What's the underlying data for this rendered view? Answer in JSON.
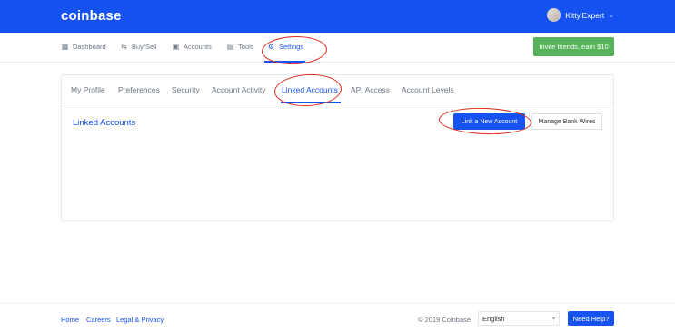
{
  "header": {
    "logo": "coinbase",
    "username": "Kitty.Expert",
    "dropdown_icon": "chevron-down-icon"
  },
  "nav": {
    "items": [
      {
        "label": "Dashboard",
        "icon": "dashboard-icon"
      },
      {
        "label": "Buy/Sell",
        "icon": "swap-icon"
      },
      {
        "label": "Accounts",
        "icon": "wallet-icon"
      },
      {
        "label": "Tools",
        "icon": "briefcase-icon"
      },
      {
        "label": "Settings",
        "icon": "gear-icon",
        "active": true
      }
    ],
    "invite_label": "Invite friends, earn $10"
  },
  "settings": {
    "tabs": [
      {
        "label": "My Profile"
      },
      {
        "label": "Preferences"
      },
      {
        "label": "Security"
      },
      {
        "label": "Account Activity"
      },
      {
        "label": "Linked Accounts",
        "active": true
      },
      {
        "label": "API Access"
      },
      {
        "label": "Account Levels"
      }
    ],
    "section_title": "Linked Accounts",
    "link_new_account_label": "Link a New Account",
    "manage_bank_wires_label": "Manage Bank Wires"
  },
  "footer": {
    "links": [
      "Home",
      "Careers",
      "Legal & Privacy"
    ],
    "copyright": "© 2019 Coinbase",
    "language": "English",
    "help_label": "Need Help?"
  },
  "colors": {
    "brand_blue": "#1652f0",
    "invite_green": "#56b35b",
    "annotation_red": "#dd2b1f"
  }
}
